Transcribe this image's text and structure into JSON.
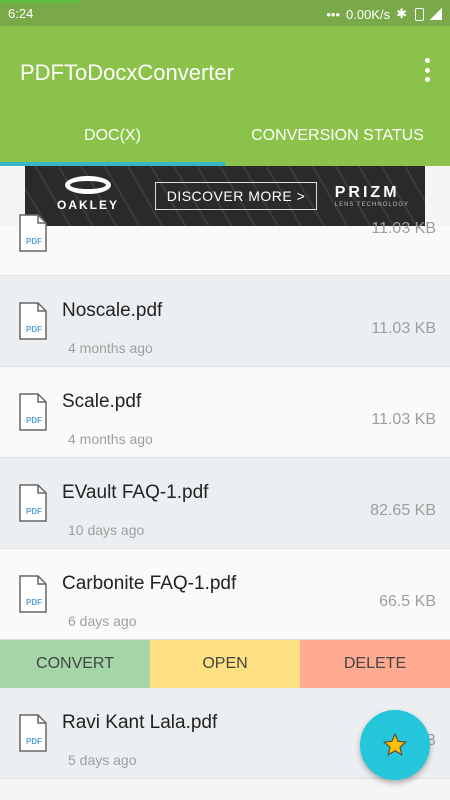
{
  "status_bar": {
    "time": "6:24",
    "dots": "•••",
    "speed": "0.00K/s",
    "bt": "✱"
  },
  "app_bar": {
    "title": "PDFToDocxConverter"
  },
  "tabs": [
    {
      "label": "DOC(X)"
    },
    {
      "label": "CONVERSION STATUS"
    }
  ],
  "ad": {
    "brand_left": "OAKLEY",
    "cta": "DISCOVER MORE >",
    "brand_right": "PRIZM",
    "brand_right_sub": "LENS TECHNOLOGY"
  },
  "files": [
    {
      "name": "",
      "date": "",
      "size": "11.03 KB"
    },
    {
      "name": "Noscale.pdf",
      "date": "4 months ago",
      "size": "11.03 KB"
    },
    {
      "name": "Scale.pdf",
      "date": "4 months ago",
      "size": "11.03 KB"
    },
    {
      "name": "EVault FAQ-1.pdf",
      "date": "10 days ago",
      "size": "82.65 KB"
    },
    {
      "name": "Carbonite FAQ-1.pdf",
      "date": "6 days ago",
      "size": "66.5 KB"
    },
    {
      "name": "Ravi Kant Lala.pdf",
      "date": "5 days ago",
      "size": "KB"
    }
  ],
  "actions": {
    "convert": "CONVERT",
    "open": "OPEN",
    "delete": "DELETE"
  },
  "icons": {
    "file": "pdf-file-icon",
    "fab": "star-icon",
    "menu": "overflow-menu-icon"
  },
  "colors": {
    "app_bar": "#8bc34a",
    "tab_indicator": "#36b7c6",
    "fab": "#26c6da",
    "star": "#ffc107",
    "convert": "#a5d6a7",
    "open": "#ffe082",
    "delete": "#ffab91"
  }
}
